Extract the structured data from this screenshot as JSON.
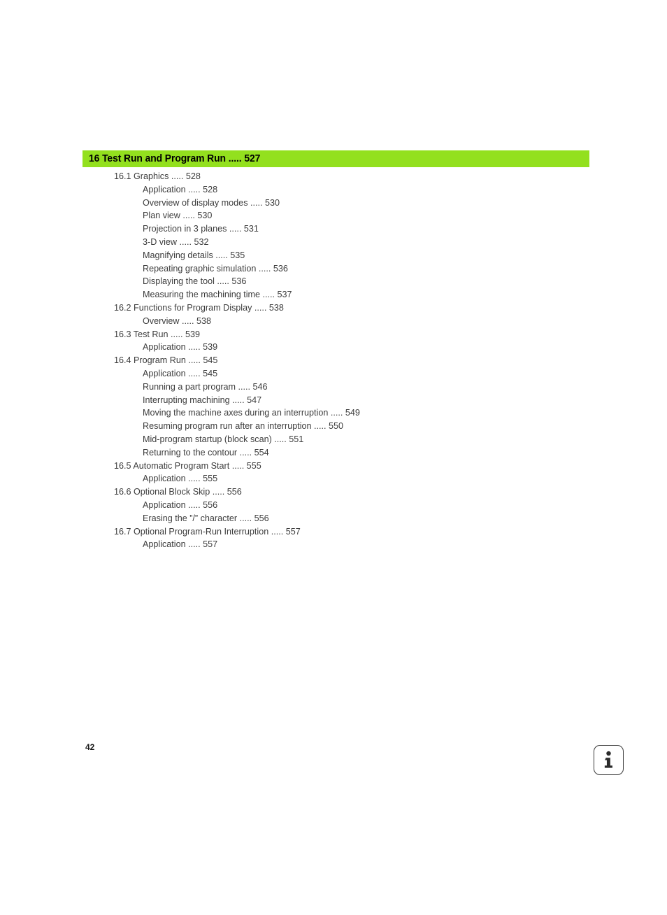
{
  "document": {
    "page_number": "42",
    "accent_color": "#93e01e",
    "text_color": "#3c3c3c"
  },
  "chapter": {
    "title": "16 Test Run and Program Run ..... 527"
  },
  "toc": {
    "entries": [
      {
        "level": 1,
        "text": "16.1 Graphics ..... 528"
      },
      {
        "level": 2,
        "text": "Application ..... 528"
      },
      {
        "level": 2,
        "text": "Overview of display modes ..... 530"
      },
      {
        "level": 2,
        "text": "Plan view ..... 530"
      },
      {
        "level": 2,
        "text": "Projection in 3 planes ..... 531"
      },
      {
        "level": 2,
        "text": "3-D view ..... 532"
      },
      {
        "level": 2,
        "text": "Magnifying details ..... 535"
      },
      {
        "level": 2,
        "text": "Repeating graphic simulation ..... 536"
      },
      {
        "level": 2,
        "text": "Displaying the tool ..... 536"
      },
      {
        "level": 2,
        "text": "Measuring the machining time ..... 537"
      },
      {
        "level": 1,
        "text": "16.2 Functions for Program Display ..... 538"
      },
      {
        "level": 2,
        "text": "Overview ..... 538"
      },
      {
        "level": 1,
        "text": "16.3 Test Run ..... 539"
      },
      {
        "level": 2,
        "text": "Application ..... 539"
      },
      {
        "level": 1,
        "text": "16.4 Program Run ..... 545"
      },
      {
        "level": 2,
        "text": "Application ..... 545"
      },
      {
        "level": 2,
        "text": "Running a part program ..... 546"
      },
      {
        "level": 2,
        "text": "Interrupting machining ..... 547"
      },
      {
        "level": 2,
        "text": "Moving the machine axes during an interruption ..... 549"
      },
      {
        "level": 2,
        "text": "Resuming program run after an interruption ..... 550"
      },
      {
        "level": 2,
        "text": "Mid-program startup (block scan) ..... 551"
      },
      {
        "level": 2,
        "text": "Returning to the contour ..... 554"
      },
      {
        "level": 1,
        "text": "16.5 Automatic Program Start ..... 555"
      },
      {
        "level": 2,
        "text": "Application ..... 555"
      },
      {
        "level": 1,
        "text": "16.6 Optional Block Skip ..... 556"
      },
      {
        "level": 2,
        "text": "Application ..... 556"
      },
      {
        "level": 2,
        "text": "Erasing the ”/” character ..... 556"
      },
      {
        "level": 1,
        "text": "16.7 Optional Program-Run Interruption ..... 557"
      },
      {
        "level": 2,
        "text": "Application ..... 557"
      }
    ]
  },
  "footer": {
    "info_icon_name": "info-icon"
  }
}
